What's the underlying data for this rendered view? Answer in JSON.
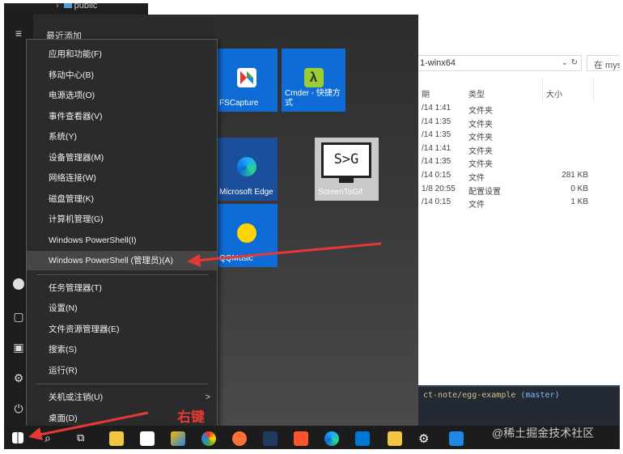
{
  "topbar": {
    "crumb": "public"
  },
  "explorer": {
    "address": "1-winx64",
    "search_placeholder": "在 mysql",
    "headers": {
      "date": "期",
      "type": "类型",
      "size": "大小"
    },
    "rows": [
      {
        "date": "/14 1:41",
        "type": "文件夹",
        "size": ""
      },
      {
        "date": "/14 1:35",
        "type": "文件夹",
        "size": ""
      },
      {
        "date": "/14 1:35",
        "type": "文件夹",
        "size": ""
      },
      {
        "date": "/14 1:41",
        "type": "文件夹",
        "size": ""
      },
      {
        "date": "/14 1:35",
        "type": "文件夹",
        "size": ""
      },
      {
        "date": "/14 0:15",
        "type": "文件",
        "size": "281 KB"
      },
      {
        "date": "1/8 20:55",
        "type": "配置设置",
        "size": "0 KB"
      },
      {
        "date": "/14 0:15",
        "type": "文件",
        "size": "1 KB"
      }
    ]
  },
  "terminal": {
    "path": "ct-note/egg-example",
    "branch": "(master)"
  },
  "start": {
    "recent_label": "最近添加",
    "tiles": {
      "fscapture": "FSCapture",
      "cmder": "Cmder - 快捷方式",
      "edge": "Microsoft Edge",
      "screentogif": "ScreenToGif",
      "screentogif_logo": "S>G",
      "qqmusic": "QQMusic"
    }
  },
  "context_menu": {
    "items_a": [
      "应用和功能(F)",
      "移动中心(B)",
      "电源选项(O)",
      "事件查看器(V)",
      "系统(Y)",
      "设备管理器(M)",
      "网络连接(W)",
      "磁盘管理(K)",
      "计算机管理(G)",
      "Windows PowerShell(I)",
      "Windows PowerShell (管理员)(A)"
    ],
    "items_b": [
      "任务管理器(T)",
      "设置(N)",
      "文件资源管理器(E)",
      "搜索(S)",
      "运行(R)"
    ],
    "items_c": [
      "关机或注销(U)",
      "桌面(D)"
    ],
    "submenu_chevron": ">"
  },
  "annotation": {
    "label": "右键"
  },
  "watermark": "@稀土掘金技术社区"
}
